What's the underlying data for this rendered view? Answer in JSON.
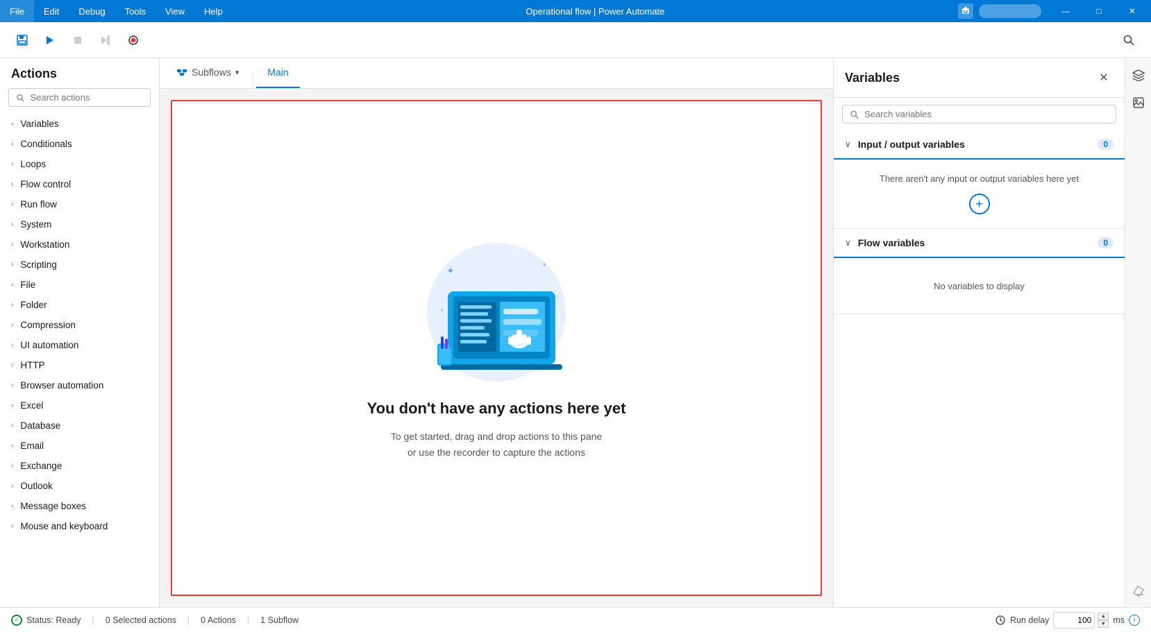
{
  "titlebar": {
    "menus": [
      "File",
      "Edit",
      "Debug",
      "Tools",
      "View",
      "Help"
    ],
    "title": "Operational flow | Power Automate",
    "minimize": "—",
    "maximize": "□",
    "close": "✕"
  },
  "toolbar": {
    "save_tooltip": "Save",
    "run_tooltip": "Run",
    "stop_tooltip": "Stop",
    "next_tooltip": "Next step",
    "record_tooltip": "Record",
    "search_tooltip": "Search"
  },
  "actions": {
    "header": "Actions",
    "search_placeholder": "Search actions",
    "items": [
      {
        "label": "Variables"
      },
      {
        "label": "Conditionals"
      },
      {
        "label": "Loops"
      },
      {
        "label": "Flow control"
      },
      {
        "label": "Run flow"
      },
      {
        "label": "System"
      },
      {
        "label": "Workstation"
      },
      {
        "label": "Scripting"
      },
      {
        "label": "File"
      },
      {
        "label": "Folder"
      },
      {
        "label": "Compression"
      },
      {
        "label": "UI automation"
      },
      {
        "label": "HTTP"
      },
      {
        "label": "Browser automation"
      },
      {
        "label": "Excel"
      },
      {
        "label": "Database"
      },
      {
        "label": "Email"
      },
      {
        "label": "Exchange"
      },
      {
        "label": "Outlook"
      },
      {
        "label": "Message boxes"
      },
      {
        "label": "Mouse and keyboard"
      }
    ]
  },
  "tabs": {
    "subflows": "Subflows",
    "main": "Main"
  },
  "canvas": {
    "empty_title": "You don't have any actions here yet",
    "empty_desc1": "To get started, drag and drop actions to this pane",
    "empty_desc2": "or use the recorder to capture the actions"
  },
  "variables": {
    "header": "Variables",
    "search_placeholder": "Search variables",
    "sections": [
      {
        "title": "Input / output variables",
        "count": "0",
        "empty_text": "There aren't any input or output variables here yet"
      },
      {
        "title": "Flow variables",
        "count": "0",
        "empty_text": "No variables to display"
      }
    ]
  },
  "statusbar": {
    "status_label": "Status: Ready",
    "selected_actions": "0 Selected actions",
    "actions_count": "0 Actions",
    "subflow_count": "1 Subflow",
    "run_delay_label": "Run delay",
    "run_delay_value": "100",
    "ms_label": "ms"
  }
}
